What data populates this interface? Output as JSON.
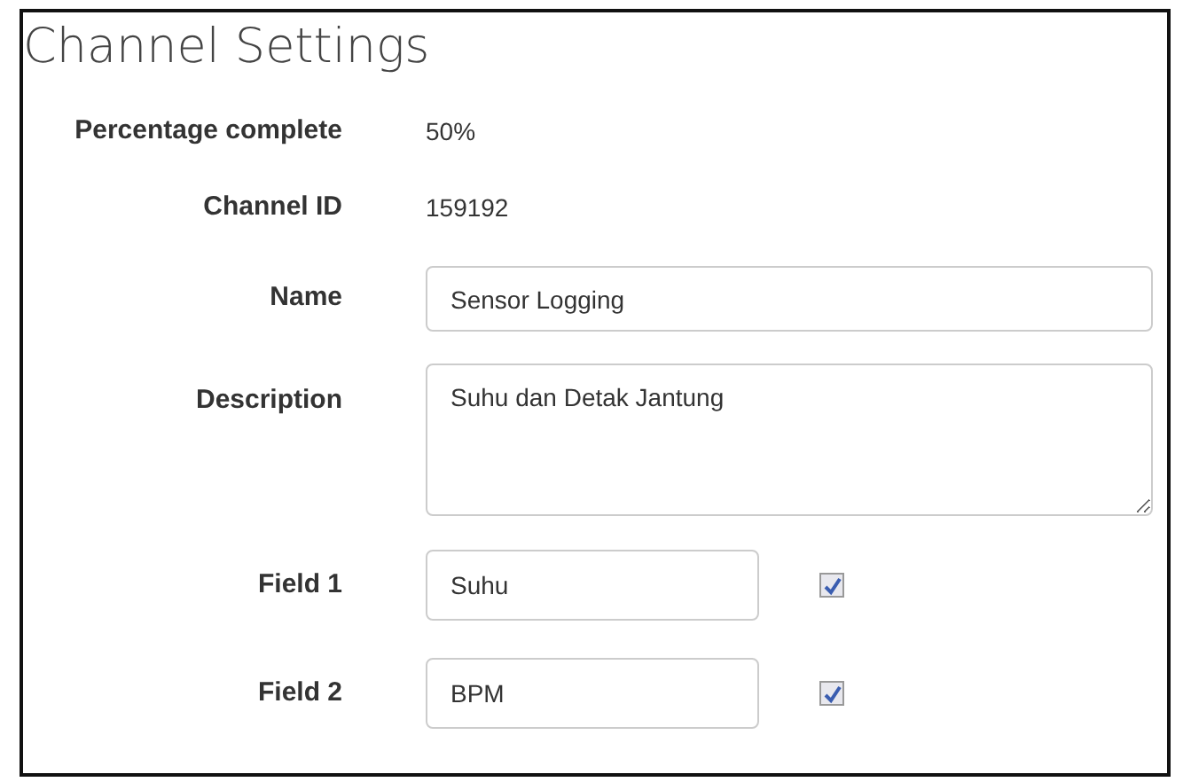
{
  "title": "Channel Settings",
  "rows": [
    {
      "kind": "text",
      "label": "Percentage complete",
      "value": "50%"
    },
    {
      "kind": "text",
      "label": "Channel ID",
      "value": "159192"
    },
    {
      "kind": "input",
      "label": "Name",
      "value": "Sensor Logging"
    },
    {
      "kind": "textarea",
      "label": "Description",
      "value": "Suhu dan Detak Jantung"
    },
    {
      "kind": "field",
      "label": "Field 1",
      "value": "Suhu",
      "checked": true
    },
    {
      "kind": "field",
      "label": "Field 2",
      "value": "BPM",
      "checked": true
    }
  ]
}
